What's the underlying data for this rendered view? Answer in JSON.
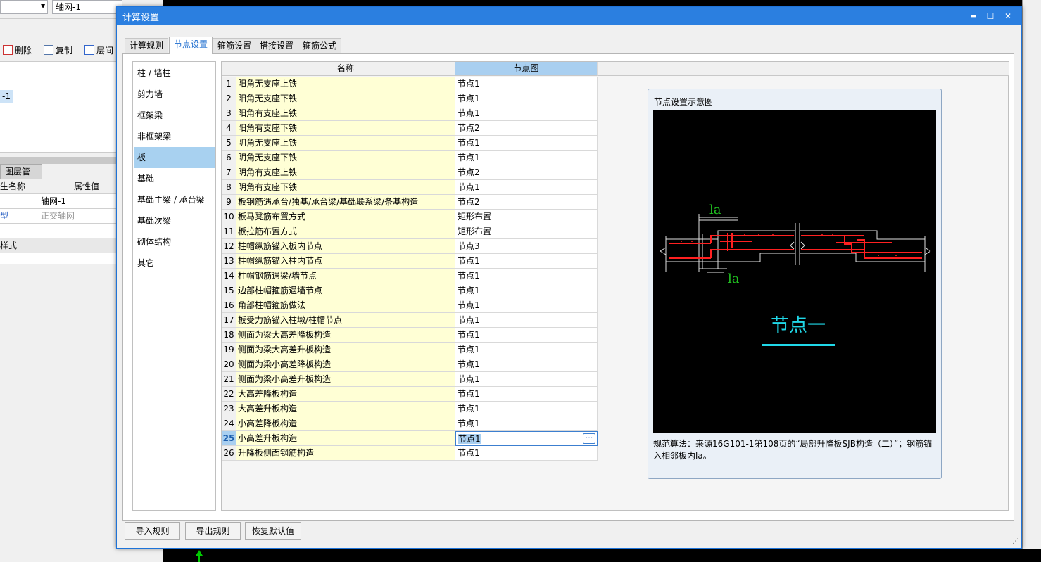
{
  "background_app": {
    "combo_left": "",
    "combo_right": "轴网-1",
    "toolbar": {
      "delete": "删除",
      "copy": "复制",
      "floor": "层间"
    },
    "tree_item": "-1",
    "panel_tab": "图层管理",
    "prop_header": {
      "name": "生名称",
      "value": "属性值"
    },
    "props": [
      {
        "name": "",
        "value": "轴网-1",
        "muted": false
      },
      {
        "name": "型",
        "value": "正交轴网",
        "muted": true
      },
      {
        "name": "",
        "value": "",
        "muted": false
      },
      {
        "name": "样式",
        "value": "",
        "muted": false
      }
    ]
  },
  "dialog": {
    "title": "计算设置",
    "window_buttons": {
      "min": "▬",
      "max": "☐",
      "close": "✕"
    },
    "tabs": [
      {
        "label": "计算规则",
        "active": false
      },
      {
        "label": "节点设置",
        "active": true
      },
      {
        "label": "箍筋设置",
        "active": false
      },
      {
        "label": "搭接设置",
        "active": false
      },
      {
        "label": "箍筋公式",
        "active": false
      }
    ],
    "categories": [
      {
        "label": "柱 / 墙柱",
        "selected": false
      },
      {
        "label": "剪力墙",
        "selected": false
      },
      {
        "label": "框架梁",
        "selected": false
      },
      {
        "label": "非框架梁",
        "selected": false
      },
      {
        "label": "板",
        "selected": true
      },
      {
        "label": "基础",
        "selected": false
      },
      {
        "label": "基础主梁 / 承台梁",
        "selected": false
      },
      {
        "label": "基础次梁",
        "selected": false
      },
      {
        "label": "砌体结构",
        "selected": false
      },
      {
        "label": "其它",
        "selected": false
      }
    ],
    "grid": {
      "header_name": "名称",
      "header_value": "节点图",
      "selected_row": 25,
      "rows": [
        {
          "no": "1",
          "name": "阳角无支座上铁",
          "value": "节点1"
        },
        {
          "no": "2",
          "name": "阳角无支座下铁",
          "value": "节点1"
        },
        {
          "no": "3",
          "name": "阳角有支座上铁",
          "value": "节点1"
        },
        {
          "no": "4",
          "name": "阳角有支座下铁",
          "value": "节点2"
        },
        {
          "no": "5",
          "name": "阴角无支座上铁",
          "value": "节点1"
        },
        {
          "no": "6",
          "name": "阴角无支座下铁",
          "value": "节点1"
        },
        {
          "no": "7",
          "name": "阴角有支座上铁",
          "value": "节点2"
        },
        {
          "no": "8",
          "name": "阴角有支座下铁",
          "value": "节点1"
        },
        {
          "no": "9",
          "name": "板钢筋遇承台/独基/承台梁/基础联系梁/条基构造",
          "value": "节点2"
        },
        {
          "no": "10",
          "name": "板马凳筋布置方式",
          "value": "矩形布置"
        },
        {
          "no": "11",
          "name": "板拉筋布置方式",
          "value": "矩形布置"
        },
        {
          "no": "12",
          "name": "柱帽纵筋锚入板内节点",
          "value": "节点3"
        },
        {
          "no": "13",
          "name": "柱帽纵筋锚入柱内节点",
          "value": "节点1"
        },
        {
          "no": "14",
          "name": "柱帽钢筋遇梁/墙节点",
          "value": "节点1"
        },
        {
          "no": "15",
          "name": "边部柱帽箍筋遇墙节点",
          "value": "节点1"
        },
        {
          "no": "16",
          "name": "角部柱帽箍筋做法",
          "value": "节点1"
        },
        {
          "no": "17",
          "name": "板受力筋锚入柱墩/柱帽节点",
          "value": "节点1"
        },
        {
          "no": "18",
          "name": "侧面为梁大高差降板构造",
          "value": "节点1"
        },
        {
          "no": "19",
          "name": "侧面为梁大高差升板构造",
          "value": "节点1"
        },
        {
          "no": "20",
          "name": "侧面为梁小高差降板构造",
          "value": "节点1"
        },
        {
          "no": "21",
          "name": "侧面为梁小高差升板构造",
          "value": "节点1"
        },
        {
          "no": "22",
          "name": "大高差降板构造",
          "value": "节点1"
        },
        {
          "no": "23",
          "name": "大高差升板构造",
          "value": "节点1"
        },
        {
          "no": "24",
          "name": "小高差降板构造",
          "value": "节点1"
        },
        {
          "no": "25",
          "name": "小高差升板构造",
          "value": "节点1"
        },
        {
          "no": "26",
          "name": "升降板侧面钢筋构造",
          "value": "节点1"
        }
      ],
      "ellipsis": "···"
    },
    "diagram": {
      "title": "节点设置示意图",
      "label_la_top": "la",
      "label_la_bottom": "la",
      "caption": "节点一",
      "description": "规范算法：来源16G101-1第108页的“局部升降板SJB构造（二）”；钢筋锚入相邻板内la。"
    },
    "buttons": {
      "import": "导入规则",
      "export": "导出规则",
      "restore": "恢复默认值"
    },
    "colors": {
      "titlebar": "#2b7fe0",
      "name_cell": "#ffffd5",
      "selection": "#a9cff0",
      "rebar": "#ff0000",
      "caption": "#20d8e8",
      "dim": "#20c020"
    }
  }
}
